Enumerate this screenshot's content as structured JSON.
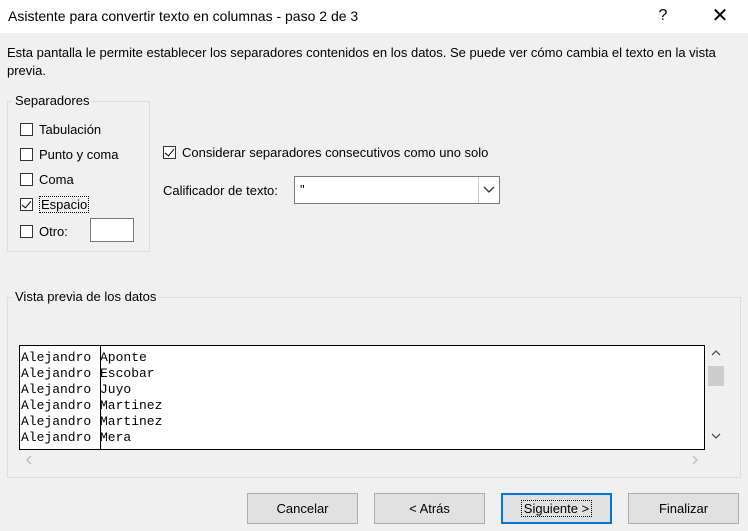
{
  "window": {
    "title": "Asistente para convertir texto en columnas - paso 2 de 3",
    "help": "?",
    "close": "✕"
  },
  "description": "Esta pantalla le permite establecer los separadores contenidos en los datos. Se puede ver cómo cambia el texto en la vista previa.",
  "separators": {
    "group_label": "Separadores",
    "items": [
      {
        "label": "Tabulación",
        "checked": false
      },
      {
        "label": "Punto y coma",
        "checked": false
      },
      {
        "label": "Coma",
        "checked": false
      },
      {
        "label": "Espacio",
        "checked": true
      },
      {
        "label": "Otro:",
        "checked": false
      }
    ]
  },
  "consecutive": {
    "label": "Considerar separadores consecutivos como uno solo",
    "checked": true
  },
  "qualifier": {
    "label": "Calificador de texto:",
    "value": "\""
  },
  "preview": {
    "group_label": "Vista previa de los datos",
    "rows": [
      [
        "Alejandro",
        "Aponte"
      ],
      [
        "Alejandro",
        "Escobar"
      ],
      [
        "Alejandro",
        "Juyo"
      ],
      [
        "Alejandro",
        "Martinez"
      ],
      [
        "Alejandro",
        "Martinez"
      ],
      [
        "Alejandro",
        "Mera"
      ]
    ]
  },
  "buttons": {
    "cancel": "Cancelar",
    "back": "< Atrás",
    "next": "Siguiente >",
    "finish": "Finalizar"
  },
  "colors": {
    "accent": "#0078d7"
  }
}
